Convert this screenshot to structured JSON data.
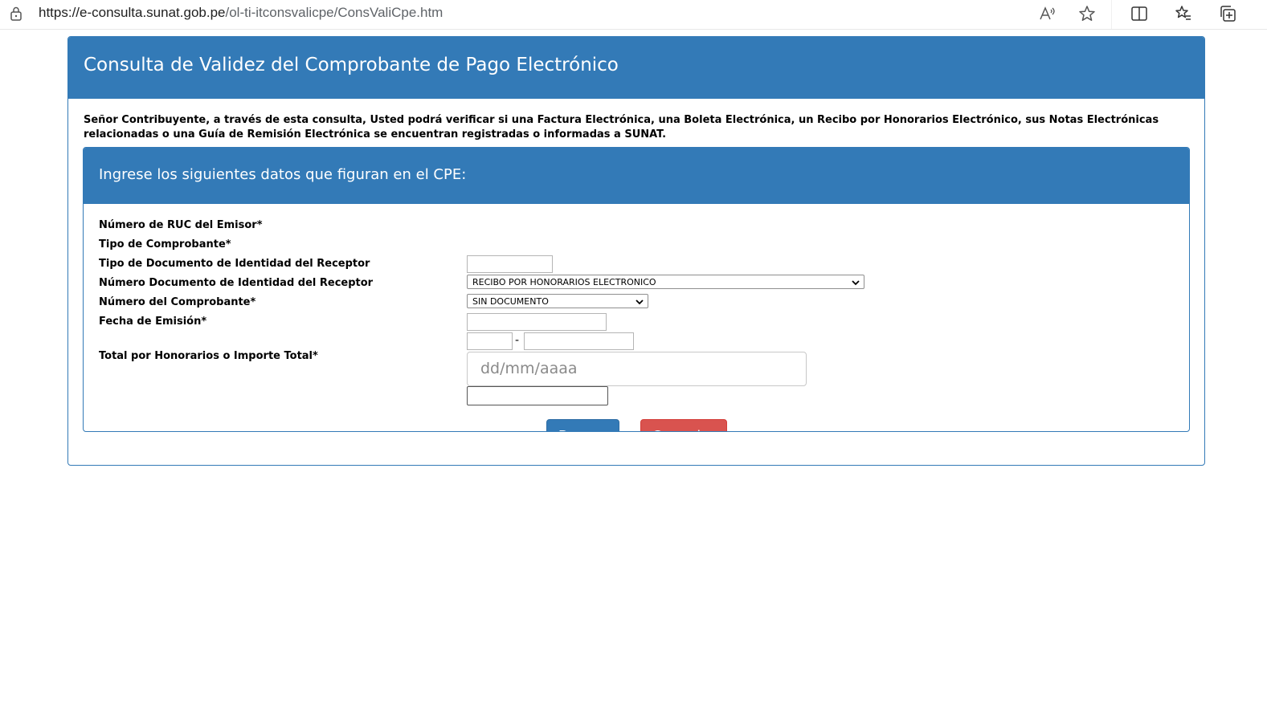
{
  "browser": {
    "url_host": "https://e-consulta.sunat.gob.pe",
    "url_path": "/ol-ti-itconsvalicpe/ConsValiCpe.htm"
  },
  "page": {
    "title": "Consulta de Validez del Comprobante de Pago Electrónico",
    "intro": "Señor Contribuyente, a través de esta consulta, Usted podrá verificar si una Factura Electrónica, una Boleta Electrónica, un Recibo por Honorarios Electrónico, sus Notas Electrónicas relacionadas o una Guía de Remisión Electrónica se encuentran registradas o informadas a SUNAT."
  },
  "form": {
    "heading": "Ingrese los siguientes datos que figuran en el CPE:",
    "labels": {
      "ruc": "Número de RUC del Emisor*",
      "tipo_comprobante": "Tipo de Comprobante*",
      "tipo_doc": "Tipo de Documento de Identidad del Receptor",
      "num_doc": "Número Documento de Identidad del Receptor",
      "num_comprobante": "Número del Comprobante*",
      "fecha": "Fecha de Emisión*",
      "total": "Total por Honorarios o Importe Total*"
    },
    "values": {
      "tipo_comprobante": "RECIBO POR HONORARIOS ELECTRONICO",
      "tipo_doc": "SIN DOCUMENTO"
    },
    "placeholders": {
      "fecha": "dd/mm/aaaa"
    },
    "separator": "-",
    "buttons": {
      "buscar": "Buscar",
      "cancelar": "Cancelar"
    }
  }
}
